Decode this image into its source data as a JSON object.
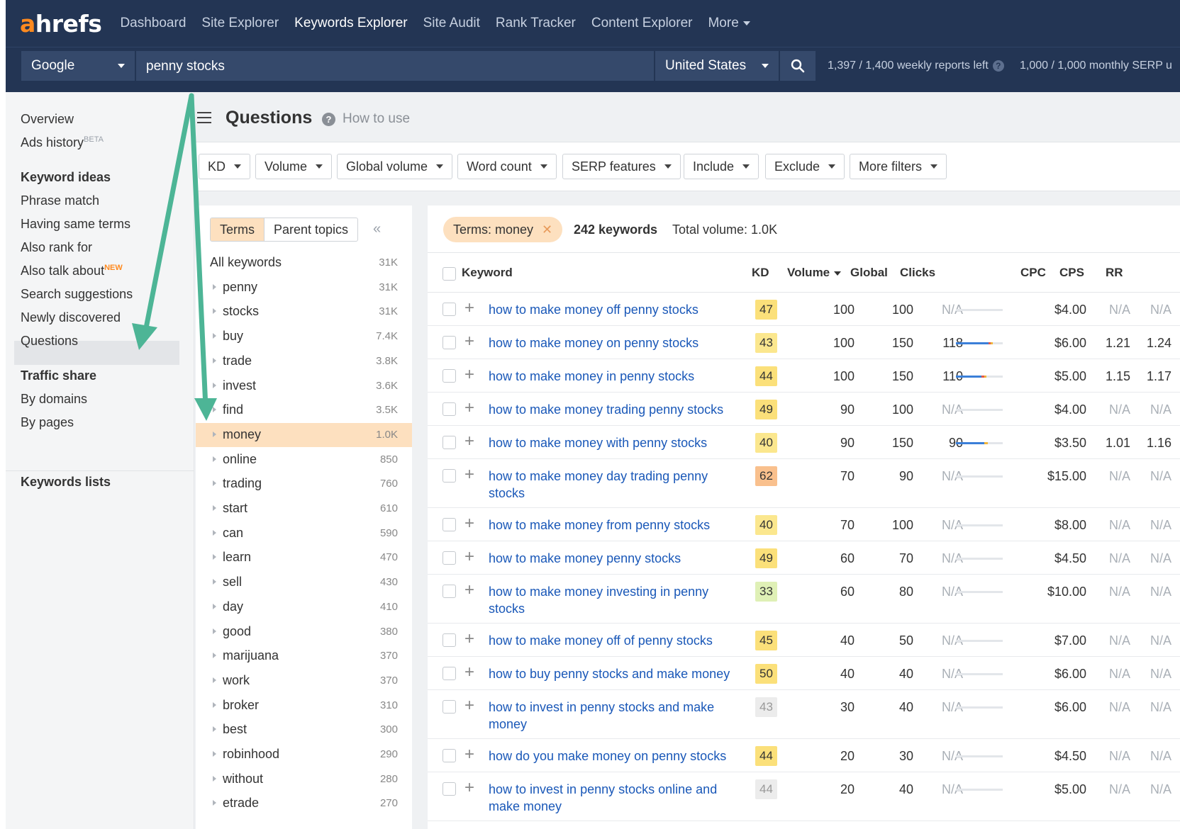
{
  "nav": {
    "logo_a": "a",
    "logo_rest": "hrefs",
    "links": [
      "Dashboard",
      "Site Explorer",
      "Keywords Explorer",
      "Site Audit",
      "Rank Tracker",
      "Content Explorer",
      "More"
    ],
    "active": "Keywords Explorer"
  },
  "search": {
    "engine": "Google",
    "query": "penny stocks",
    "country": "United States",
    "weekly_reports": "1,397 / 1,400 weekly reports left",
    "monthly_serp": "1,000 / 1,000 monthly SERP u"
  },
  "sidebar": {
    "overview": "Overview",
    "ads_history": "Ads history",
    "beta": "BETA",
    "keyword_ideas_head": "Keyword ideas",
    "phrase_match": "Phrase match",
    "having_same_terms": "Having same terms",
    "also_rank_for": "Also rank for",
    "also_talk_about": "Also talk about",
    "new_badge": "NEW",
    "search_suggestions": "Search suggestions",
    "newly_discovered": "Newly discovered",
    "questions": "Questions",
    "traffic_share_head": "Traffic share",
    "by_domains": "By domains",
    "by_pages": "By pages",
    "keywords_lists_head": "Keywords lists"
  },
  "page": {
    "title": "Questions",
    "how_to_use": "How to use",
    "help_glyph": "?"
  },
  "filters": [
    "KD",
    "Volume",
    "Global volume",
    "Word count",
    "SERP features",
    "Include",
    "Exclude",
    "More filters"
  ],
  "terms_panel": {
    "tab_terms": "Terms",
    "tab_parent": "Parent topics",
    "collapse_glyph": "«",
    "all_label": "All keywords",
    "all_count": "31K",
    "items": [
      {
        "name": "penny",
        "count": "31K"
      },
      {
        "name": "stocks",
        "count": "31K"
      },
      {
        "name": "buy",
        "count": "7.4K"
      },
      {
        "name": "trade",
        "count": "3.8K"
      },
      {
        "name": "invest",
        "count": "3.6K"
      },
      {
        "name": "find",
        "count": "3.5K"
      },
      {
        "name": "money",
        "count": "1.0K"
      },
      {
        "name": "online",
        "count": "850"
      },
      {
        "name": "trading",
        "count": "760"
      },
      {
        "name": "start",
        "count": "610"
      },
      {
        "name": "can",
        "count": "590"
      },
      {
        "name": "learn",
        "count": "470"
      },
      {
        "name": "sell",
        "count": "430"
      },
      {
        "name": "day",
        "count": "410"
      },
      {
        "name": "good",
        "count": "380"
      },
      {
        "name": "marijuana",
        "count": "370"
      },
      {
        "name": "work",
        "count": "370"
      },
      {
        "name": "broker",
        "count": "310"
      },
      {
        "name": "best",
        "count": "300"
      },
      {
        "name": "robinhood",
        "count": "290"
      },
      {
        "name": "without",
        "count": "280"
      },
      {
        "name": "etrade",
        "count": "270"
      }
    ],
    "selected": "money"
  },
  "results": {
    "chip": "Terms: money",
    "chip_close": "✕",
    "keyword_count": "242 keywords",
    "total_volume": "Total volume: 1.0K",
    "columns": {
      "keyword": "Keyword",
      "kd": "KD",
      "volume": "Volume",
      "global": "Global",
      "clicks": "Clicks",
      "cpc": "CPC",
      "cps": "CPS",
      "rr": "RR"
    },
    "rows": [
      {
        "keyword": "how to make money off penny stocks",
        "kd": "47",
        "volume": "100",
        "global": "100",
        "clicks": "N/A",
        "cpc": "$4.00",
        "cps": "N/A",
        "rr": "N/A"
      },
      {
        "keyword": "how to make money on penny stocks",
        "kd": "43",
        "volume": "100",
        "global": "150",
        "clicks": "118",
        "cpc": "$6.00",
        "cps": "1.21",
        "rr": "1.24"
      },
      {
        "keyword": "how to make money in penny stocks",
        "kd": "44",
        "volume": "100",
        "global": "150",
        "clicks": "110",
        "cpc": "$5.00",
        "cps": "1.15",
        "rr": "1.17"
      },
      {
        "keyword": "how to make money trading penny stocks",
        "kd": "49",
        "volume": "90",
        "global": "100",
        "clicks": "N/A",
        "cpc": "$4.00",
        "cps": "N/A",
        "rr": "N/A"
      },
      {
        "keyword": "how to make money with penny stocks",
        "kd": "40",
        "volume": "90",
        "global": "150",
        "clicks": "90",
        "cpc": "$3.50",
        "cps": "1.01",
        "rr": "1.16"
      },
      {
        "keyword": "how to make money day trading penny stocks",
        "kd": "62",
        "volume": "70",
        "global": "90",
        "clicks": "N/A",
        "cpc": "$15.00",
        "cps": "N/A",
        "rr": "N/A"
      },
      {
        "keyword": "how to make money from penny stocks",
        "kd": "40",
        "volume": "70",
        "global": "100",
        "clicks": "N/A",
        "cpc": "$8.00",
        "cps": "N/A",
        "rr": "N/A"
      },
      {
        "keyword": "how to make money penny stocks",
        "kd": "49",
        "volume": "60",
        "global": "70",
        "clicks": "N/A",
        "cpc": "$4.50",
        "cps": "N/A",
        "rr": "N/A"
      },
      {
        "keyword": "how to make money investing in penny stocks",
        "kd": "33",
        "volume": "60",
        "global": "80",
        "clicks": "N/A",
        "cpc": "$10.00",
        "cps": "N/A",
        "rr": "N/A"
      },
      {
        "keyword": "how to make money off of penny stocks",
        "kd": "45",
        "volume": "40",
        "global": "50",
        "clicks": "N/A",
        "cpc": "$7.00",
        "cps": "N/A",
        "rr": "N/A"
      },
      {
        "keyword": "how to buy penny stocks and make money",
        "kd": "50",
        "volume": "40",
        "global": "40",
        "clicks": "N/A",
        "cpc": "$6.00",
        "cps": "N/A",
        "rr": "N/A"
      },
      {
        "keyword": "how to invest in penny stocks and make money",
        "kd": "43",
        "volume": "30",
        "global": "40",
        "clicks": "N/A",
        "cpc": "$6.00",
        "cps": "N/A",
        "rr": "N/A"
      },
      {
        "keyword": "how do you make money on penny stocks",
        "kd": "44",
        "volume": "20",
        "global": "30",
        "clicks": "N/A",
        "cpc": "$4.50",
        "cps": "N/A",
        "rr": "N/A"
      },
      {
        "keyword": "how to invest in penny stocks online and make money",
        "kd": "44",
        "volume": "20",
        "global": "40",
        "clicks": "N/A",
        "cpc": "$5.00",
        "cps": "N/A",
        "rr": "N/A"
      }
    ]
  },
  "colors": {
    "nav_bg": "#233554",
    "accent_orange": "#ff8a1f",
    "selection": "#fde0bf",
    "link_blue": "#1a58b8",
    "annotation_arrow": "#4db596"
  }
}
